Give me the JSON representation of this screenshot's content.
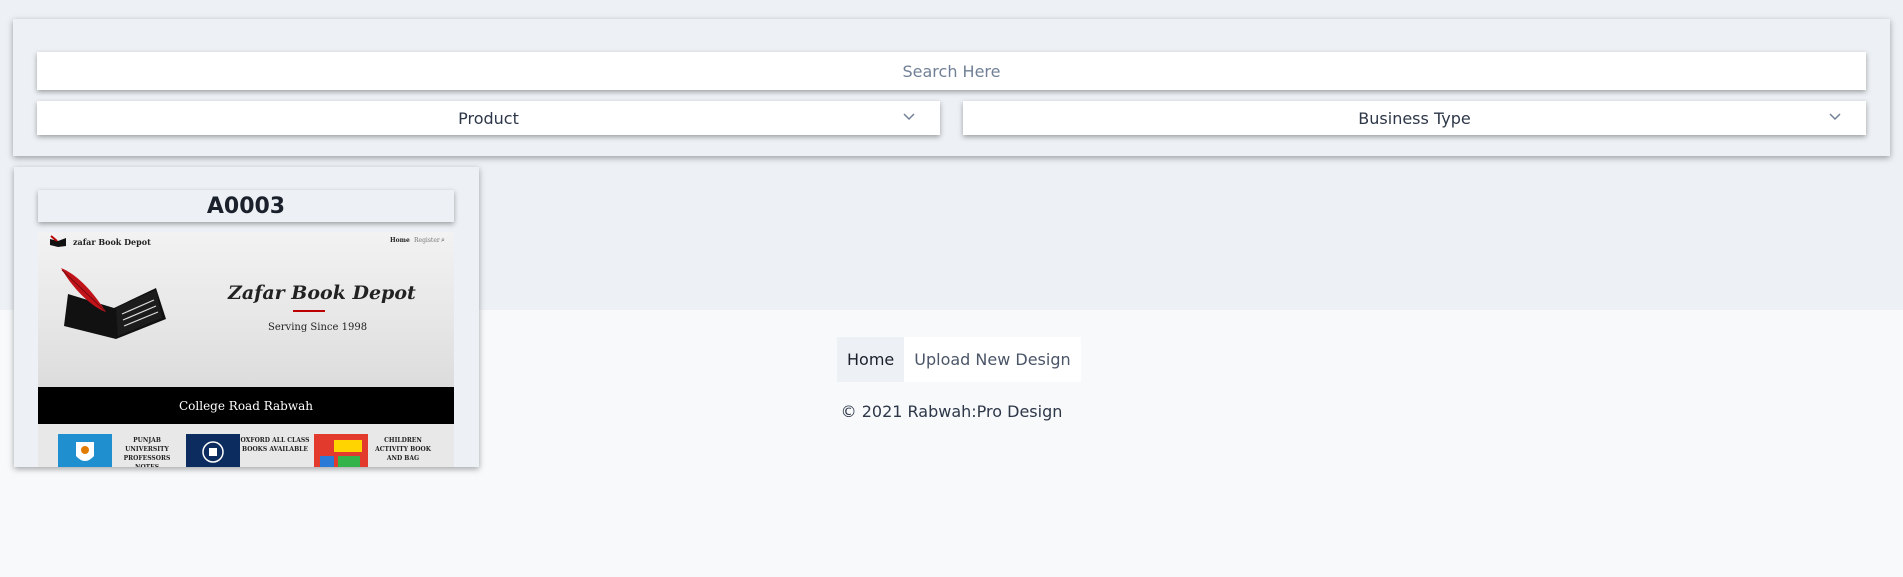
{
  "search": {
    "placeholder": "Search Here"
  },
  "filters": {
    "product_label": "Product",
    "business_type_label": "Business Type"
  },
  "card": {
    "code": "A0003",
    "preview": {
      "brand": "zafar Book Depot",
      "nav_home": "Home",
      "nav_register": "Register",
      "hero_title": "Zafar Book Depot",
      "hero_subtitle": "Serving Since 1998",
      "band_text": "College Road Rabwah",
      "tiles": [
        {
          "text": "PUNJAB UNIVERSITY PROFESSORS NOTES"
        },
        {
          "text": "OXFORD ALL CLASS BOOKS AVAILABLE"
        },
        {
          "text": "CHILDREN ACTIVITY BOOK AND BAG"
        }
      ]
    }
  },
  "footer": {
    "nav_home": "Home",
    "nav_upload": "Upload New Design",
    "copyright": "© 2021 Rabwah:Pro Design"
  },
  "colors": {
    "page_bg": "#f7f9fb",
    "band_bg": "#edf1f5",
    "accent_red": "#b00000"
  },
  "icons": {
    "select_arrow": "chevron-down-icon",
    "preview_logo": "book-quill-icon",
    "preview_search": "search-icon"
  }
}
